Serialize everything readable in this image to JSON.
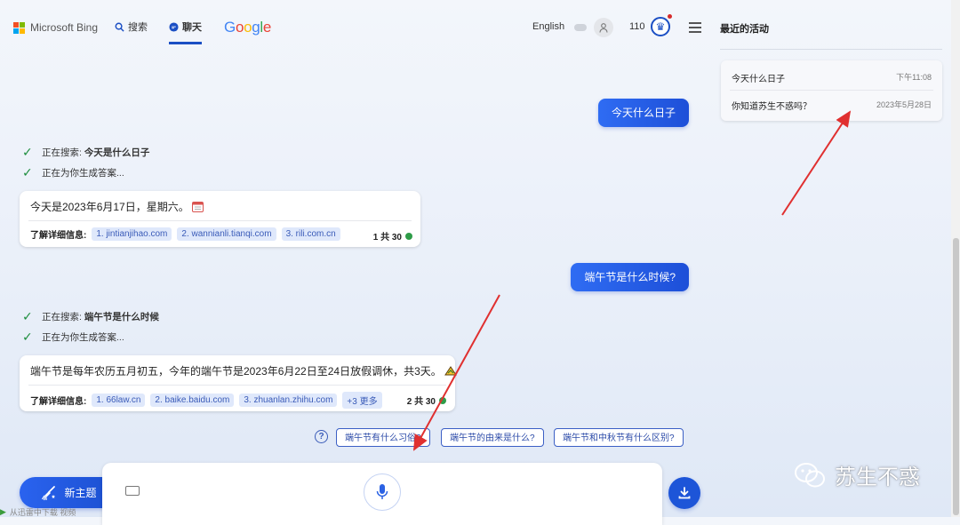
{
  "header": {
    "brand": "Microsoft Bing",
    "nav_search": "搜索",
    "nav_chat": "聊天",
    "google": [
      "G",
      "o",
      "o",
      "g",
      "l",
      "e"
    ],
    "google_colors": [
      "#4285F4",
      "#EA4335",
      "#FBBC05",
      "#4285F4",
      "#34A853",
      "#EA4335"
    ],
    "language": "English",
    "points": "110",
    "menu_icon": "hamburger-menu-icon"
  },
  "recent": {
    "title": "最近的活动",
    "items": [
      {
        "title": "今天什么日子",
        "time": "下午11:08"
      },
      {
        "title": "你知道苏生不惑吗？",
        "time": "2023年5月28日"
      }
    ]
  },
  "conversation": {
    "q1": "今天什么日子",
    "q1_search_prefix": "正在搜索:",
    "q1_search_term": "今天是什么日子",
    "q1_generating": "正在为你生成答案...",
    "a1_text": "今天是2023年6月17日，星期六。",
    "a1_refs_label": "了解详细信息:",
    "a1_refs": [
      "1. jintianjihao.com",
      "2. wannianli.tianqi.com",
      "3. rili.com.cn"
    ],
    "a1_count": "1 共 30",
    "q2": "端午节是什么时候?",
    "q2_search_prefix": "正在搜索:",
    "q2_search_term": "端午节是什么时候",
    "q2_generating": "正在为你生成答案...",
    "a2_text": "端午节是每年农历五月初五，今年的端午节是2023年6月22日至24日放假调休，共3天。",
    "a2_refs_label": "了解详细信息:",
    "a2_refs": [
      "1. 66law.cn",
      "2. baike.baidu.com",
      "3. zhuanlan.zhihu.com",
      "+3 更多"
    ],
    "a2_count": "2 共 30"
  },
  "suggestions": [
    "端午节有什么习俗?",
    "端午节的由来是什么?",
    "端午节和中秋节有什么区别?"
  ],
  "bottom": {
    "new_topic": "新主题",
    "taskbar_text": "从迅雷中下载 视频"
  },
  "watermark": "苏生不惑",
  "colors": {
    "accent": "#1d55d8",
    "annotation_arrow": "#e03030"
  }
}
